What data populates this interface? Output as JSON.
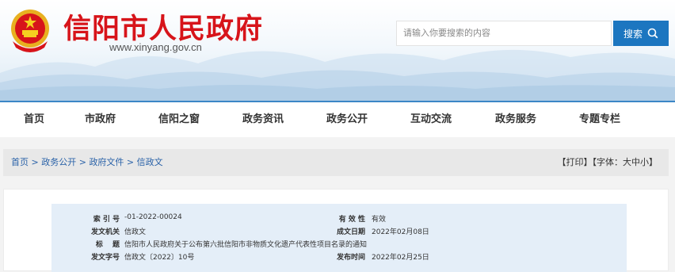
{
  "header": {
    "site_title": "信阳市人民政府",
    "site_url": "www.xinyang.gov.cn",
    "emblem_icon": "national-emblem-icon",
    "brand_color": "#d7141a"
  },
  "search": {
    "placeholder": "请输入你要搜索的内容",
    "button_label": "搜索",
    "button_icon": "search-icon",
    "button_color": "#1c76c0"
  },
  "nav": {
    "items": [
      "首页",
      "市政府",
      "信阳之窗",
      "政务资讯",
      "政务公开",
      "互动交流",
      "政务服务",
      "专题专栏"
    ]
  },
  "breadcrumb": {
    "items": [
      "首页",
      "政务公开",
      "政府文件",
      "信政文"
    ],
    "separator": " > ",
    "print": "【打印】",
    "font_prefix": "【字体：",
    "font_large": "大",
    "font_medium": "中",
    "font_small": "小",
    "font_suffix": "】"
  },
  "document_info": {
    "index_label": "索 引 号",
    "index_value": "-01-2022-00024",
    "validity_label": "有 效 性",
    "validity_value": "有效",
    "issuer_label": "发文机关",
    "issuer_value": "信政文",
    "date_label": "成文日期",
    "date_value": "2022年02月08日",
    "title_label": "标　 题",
    "title_value": "信阳市人民政府关于公布第六批信阳市非物质文化遗产代表性项目名录的通知",
    "docno_label": "发文字号",
    "docno_value": "信政文〔2022〕10号",
    "publish_label": "发布时间",
    "publish_value": "2022年02月25日"
  }
}
